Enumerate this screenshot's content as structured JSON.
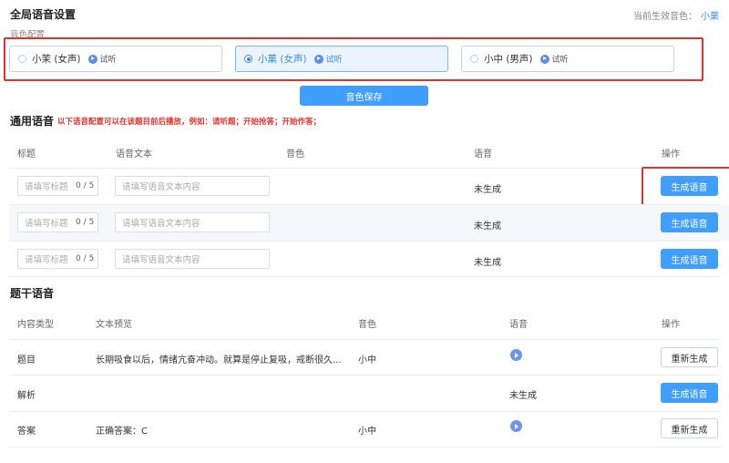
{
  "global": {
    "title": "全局语音设置",
    "current_label": "当前生效音色：",
    "current_value": "小菓",
    "config_label": "音色配置",
    "options": [
      {
        "name": "小茉 (女声)",
        "try": "试听",
        "selected": false
      },
      {
        "name": "小菓 (女声)",
        "try": "试听",
        "selected": true
      },
      {
        "name": "小中 (男声)",
        "try": "试听",
        "selected": false
      }
    ],
    "save_label": "音色保存"
  },
  "common": {
    "title": "通用语音",
    "note": "以下语音配置可以在该题目前后播放，例如：请听题；开始抢答；开始作答；",
    "headers": [
      "标题",
      "语音文本",
      "音色",
      "语音",
      "操作"
    ],
    "rows": [
      {
        "title_placeholder": "请填写标题",
        "count": "0 / 5",
        "text_placeholder": "请填写语音文本内容",
        "voice": "",
        "status": "未生成",
        "action": "生成语音"
      },
      {
        "title_placeholder": "请填写标题",
        "count": "0 / 5",
        "text_placeholder": "请填写语音文本内容",
        "voice": "",
        "status": "未生成",
        "action": "生成语音"
      },
      {
        "title_placeholder": "请填写标题",
        "count": "0 / 5",
        "text_placeholder": "请填写语音文本内容",
        "voice": "",
        "status": "未生成",
        "action": "生成语音"
      }
    ]
  },
  "stem": {
    "title": "题干语音",
    "headers": [
      "内容类型",
      "文本预览",
      "音色",
      "语音",
      "操作"
    ],
    "rows": [
      {
        "type": "题目",
        "preview": "长期吸食以后，情绪亢奋冲动。就算是停止复吸，戒断很久...",
        "voice": "小中",
        "audio": "play",
        "action": "重新生成"
      },
      {
        "type": "解析",
        "preview": "",
        "voice": "",
        "audio": "未生成",
        "action": "生成语音"
      },
      {
        "type": "答案",
        "preview": "正确答案：C",
        "voice": "小中",
        "audio": "play",
        "action": "重新生成"
      }
    ]
  }
}
